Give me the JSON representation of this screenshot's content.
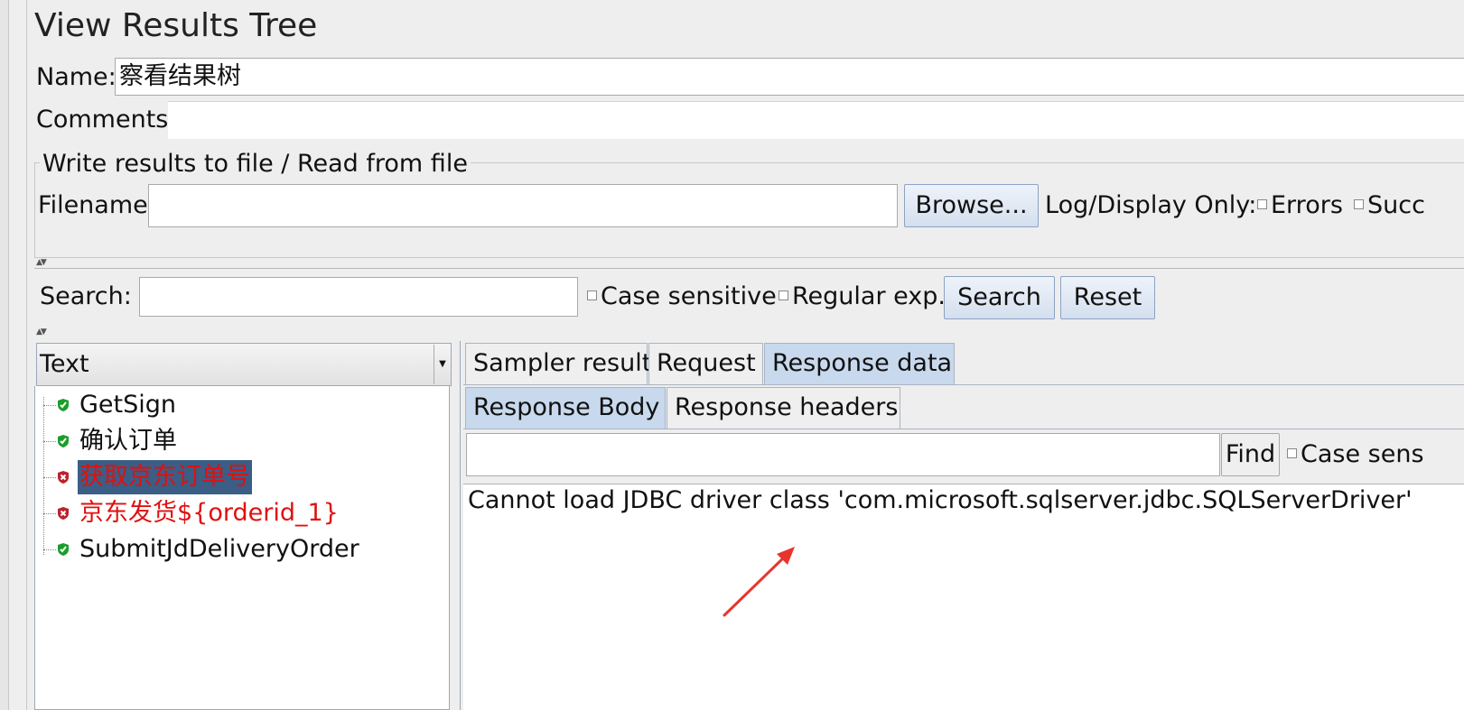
{
  "window": {
    "title": "View Results Tree"
  },
  "form": {
    "name_label": "Name:",
    "name_value": "察看结果树",
    "comments_label": "Comments:",
    "comments_value": ""
  },
  "file_group": {
    "title": "Write results to file / Read from file",
    "filename_label": "Filename",
    "filename_value": "",
    "browse_label": "Browse...",
    "log_display_label": "Log/Display Only:",
    "errors_label": "Errors",
    "successes_label": "Succ"
  },
  "search": {
    "label": "Search:",
    "value": "",
    "case_sensitive_label": "Case sensitive",
    "regex_label": "Regular exp.",
    "search_button": "Search",
    "reset_button": "Reset"
  },
  "tree": {
    "renderer_label": "Text",
    "items": [
      {
        "label": "GetSign",
        "status": "success",
        "color": "#111111",
        "selected": false
      },
      {
        "label": "确认订单",
        "status": "success",
        "color": "#111111",
        "selected": false
      },
      {
        "label": "获取京东订单号",
        "status": "error",
        "color": "#e01010",
        "selected": true
      },
      {
        "label": "京东发货${orderid_1}",
        "status": "error",
        "color": "#e01010",
        "selected": false
      },
      {
        "label": "SubmitJdDeliveryOrder",
        "status": "success",
        "color": "#111111",
        "selected": false
      }
    ]
  },
  "tabs": {
    "main": [
      "Sampler result",
      "Request",
      "Response data"
    ],
    "main_active": "Response data",
    "sub": [
      "Response Body",
      "Response headers"
    ],
    "sub_active": "Response Body"
  },
  "find": {
    "value": "",
    "button": "Find",
    "case_label": "Case sens"
  },
  "response": {
    "body": "Cannot load JDBC driver class 'com.microsoft.sqlserver.jdbc.SQLServerDriver'"
  },
  "colors": {
    "success_icon": "#1a9e2a",
    "error_icon": "#c0202a",
    "selection_bg": "#3a5e86",
    "annotation_arrow": "#e8352c"
  }
}
